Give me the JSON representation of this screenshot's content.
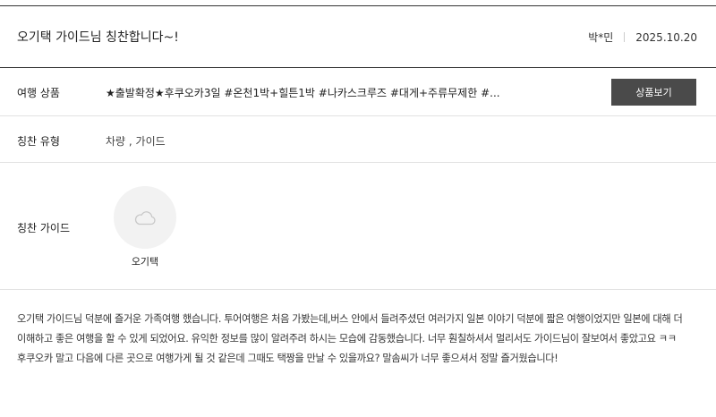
{
  "header": {
    "title": "오기택 가이드님 칭찬합니다~!",
    "author": "박*민",
    "date": "2025.10.20"
  },
  "product": {
    "label": "여행 상품",
    "name": "★출발확정★후쿠오카3일 #온천1박+힐튼1박 #나카스크루즈 #대게+주류무제한 #...",
    "button_label": "상품보기"
  },
  "praise_type": {
    "label": "칭찬 유형",
    "value": "차량 , 가이드"
  },
  "guide": {
    "label": "칭찬 가이드",
    "name": "오기택",
    "avatar_icon": "cloud-icon"
  },
  "review": {
    "text": "오기택 가이드님 덕분에 즐거운 가족여행 했습니다. 투어여행은 처음 가봤는데,버스 안에서 들려주셨던 여러가지 일본 이야기 덕분에 짧은 여행이었지만 일본에 대해 더 이해하고 좋은 여행을 할 수 있게 되었어요. 유익한 정보를 많이 알려주려 하시는 모습에 감동했습니다. 너무 훤칠하셔서 멀리서도 가이드님이 잘보여서 좋았고요 ㅋㅋ 후쿠오카 말고 다음에 다른 곳으로 여행가게 될 것 같은데 그때도 택짱을 만날 수 있을까요? 말솜씨가 너무 좋으셔서 정말 즐거웠습니다!"
  },
  "colors": {
    "button_bg": "#4a4a4a",
    "avatar_bg": "#f2f2f2",
    "divider": "#e2e2e2"
  }
}
